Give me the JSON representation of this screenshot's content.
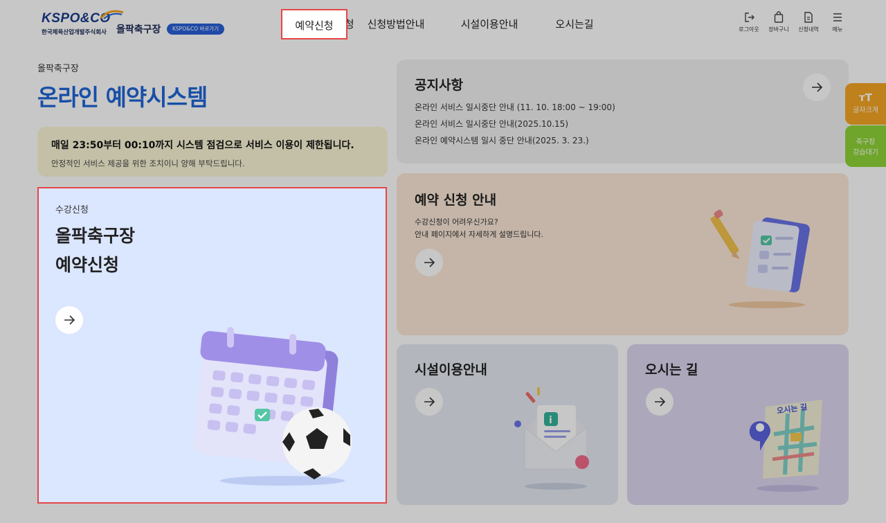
{
  "header": {
    "brand": "KSPO&CO",
    "org_name": "한국체육산업개발주식회사",
    "venue_name": "올팍축구장",
    "shortcut_label": "KSPO&CO 바로가기",
    "nav": [
      "예약신청",
      "신청방법안내",
      "시설이용안내",
      "오시는길"
    ],
    "utility": [
      "로그아웃",
      "장바구니",
      "신청내역",
      "메뉴"
    ]
  },
  "left": {
    "breadcrumb": "올팍축구장",
    "title": "온라인 예약시스템",
    "notice_strong": "매일 23:50부터 00:10까지 시스템 점검으로 서비스 이용이 제한됩니다.",
    "notice_sub": "안정적인 서비스 제공을 위한 조치이니 양해 부탁드립니다.",
    "card": {
      "kicker": "수강신청",
      "title_line1": "올팍축구장",
      "title_line2": "예약신청"
    }
  },
  "notices": {
    "title": "공지사항",
    "items": [
      "온라인 서비스 일시중단 안내 (11. 10. 18:00 ~ 19:00)",
      "온라인 서비스 일시중단 안내(2025.10.15)",
      "온라인 예약시스템 일시 중단 안내(2025. 3. 23.)"
    ]
  },
  "guide": {
    "title": "예약 신청 안내",
    "line1": "수강신청이 어려우신가요?",
    "line2": "안내 페이지에서 자세하게 설명드립니다."
  },
  "facility": {
    "title": "시설이용안내"
  },
  "map": {
    "title": "오시는 길",
    "sign": "오시는 길"
  },
  "side": {
    "font_size_label": "글자크게",
    "wait_line1": "축구장",
    "wait_line2": "강습대기"
  },
  "colors": {
    "accent_blue": "#1f66d6",
    "highlight_red": "#e64545",
    "side_orange": "#f5a623",
    "side_green": "#8fd437"
  }
}
